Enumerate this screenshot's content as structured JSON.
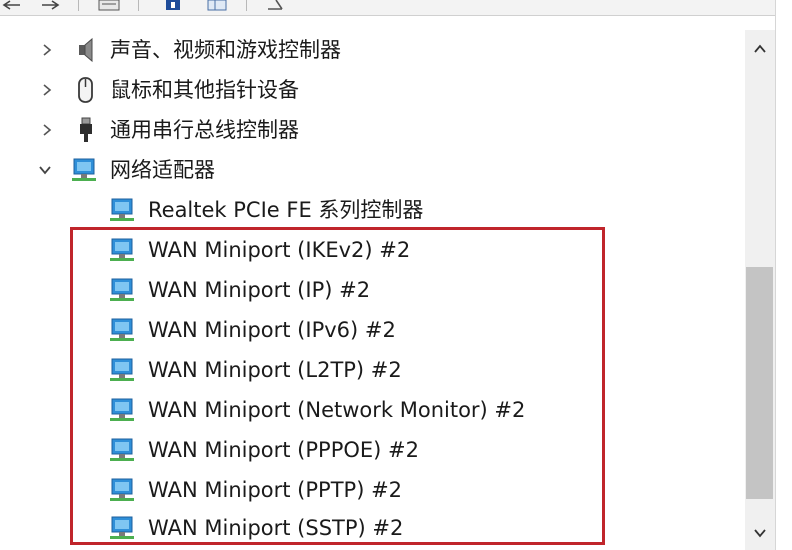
{
  "tree": {
    "categories": [
      {
        "label": "声音、视频和游戏控制器",
        "icon": "speaker-icon",
        "expanded": false
      },
      {
        "label": "鼠标和其他指针设备",
        "icon": "mouse-icon",
        "expanded": false
      },
      {
        "label": "通用串行总线控制器",
        "icon": "usb-icon",
        "expanded": false
      },
      {
        "label": "网络适配器",
        "icon": "network-adapter-icon",
        "expanded": true
      }
    ],
    "adapters": [
      "Realtek PCIe FE 系列控制器",
      "WAN Miniport (IKEv2) #2",
      "WAN Miniport (IP) #2",
      "WAN Miniport (IPv6) #2",
      "WAN Miniport (L2TP) #2",
      "WAN Miniport (Network Monitor) #2",
      "WAN Miniport (PPPOE) #2",
      "WAN Miniport (PPTP) #2",
      "WAN Miniport (SSTP) #2"
    ]
  },
  "colors": {
    "highlight_border": "#c0252b",
    "network_icon": "#2f8fd8",
    "scroll_thumb": "#c4c4c4"
  }
}
